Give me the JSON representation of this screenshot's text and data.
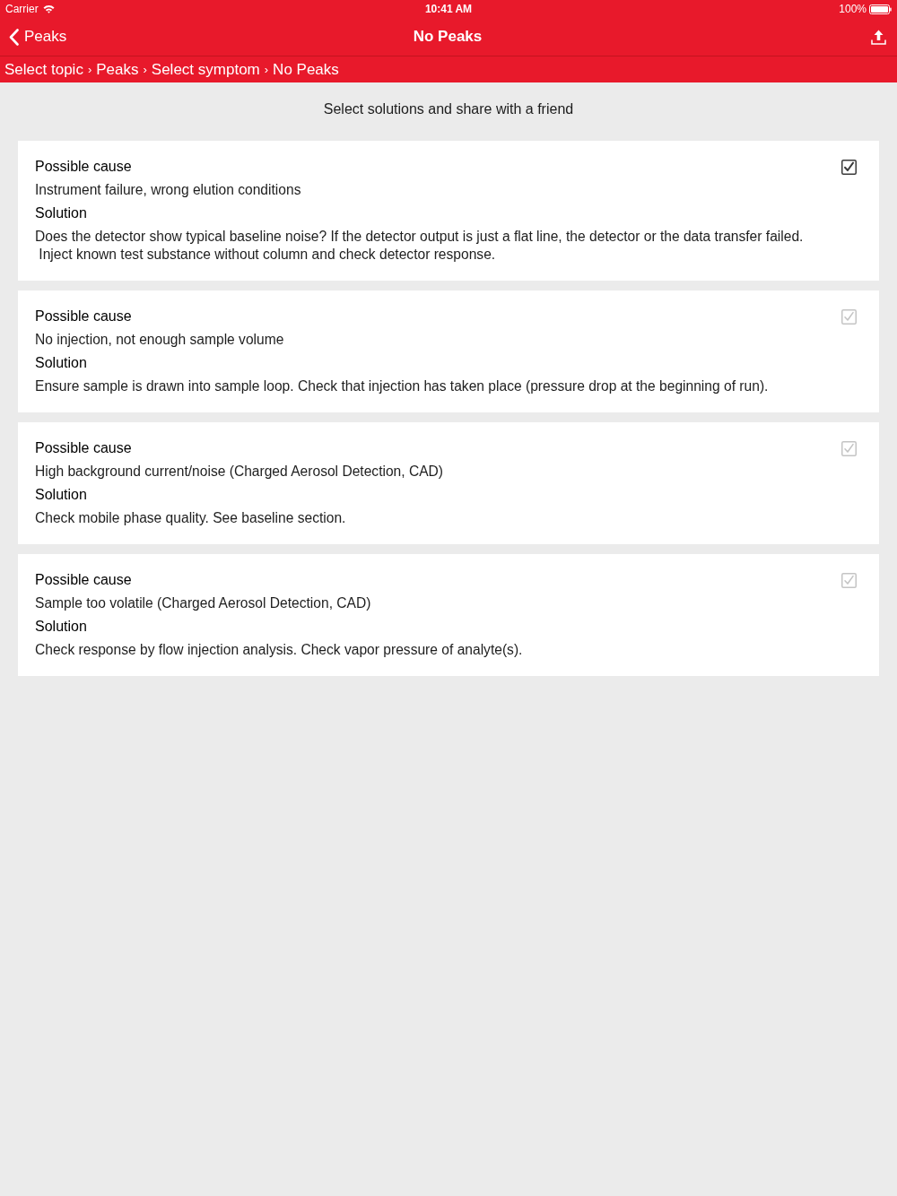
{
  "status_bar": {
    "carrier": "Carrier",
    "time": "10:41 AM",
    "battery": "100%"
  },
  "nav_bar": {
    "back_label": "Peaks",
    "title": "No Peaks"
  },
  "breadcrumb": {
    "separator": "›",
    "items": [
      "Select topic",
      "Peaks",
      "Select symptom",
      "No Peaks"
    ]
  },
  "intro": "Select solutions and share with a friend",
  "cards": [
    {
      "cause_label": "Possible cause",
      "cause": "Instrument failure, wrong elution conditions",
      "solution_label": "Solution",
      "solution": "Does the detector show typical baseline noise? If the detector output is just a flat line, the detector or the data transfer failed.\n Inject known test substance without column and check detector response.",
      "selected": true
    },
    {
      "cause_label": "Possible cause",
      "cause": "No injection, not enough sample volume",
      "solution_label": "Solution",
      "solution": "Ensure sample is drawn into sample loop. Check that injection has taken place (pressure drop at the beginning of run).",
      "selected": false
    },
    {
      "cause_label": "Possible cause",
      "cause": "High background current/noise (Charged Aerosol Detection, CAD)",
      "solution_label": "Solution",
      "solution": "Check mobile phase quality. See baseline section.",
      "selected": false
    },
    {
      "cause_label": "Possible cause",
      "cause": "Sample too volatile (Charged Aerosol Detection, CAD)",
      "solution_label": "Solution",
      "solution": "Check response by flow injection analysis. Check vapor pressure of analyte(s).",
      "selected": false
    }
  ]
}
